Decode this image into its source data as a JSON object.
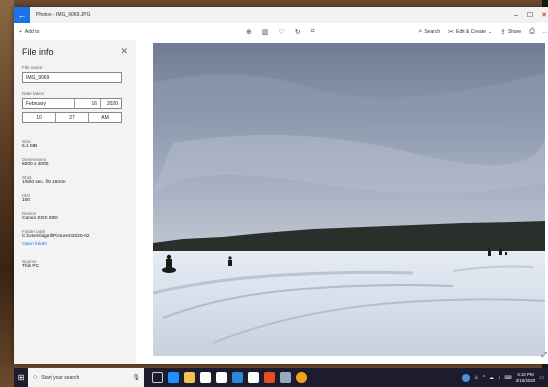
{
  "window": {
    "title": "Photos - IMG_9069.JPG",
    "back_icon": "back-arrow-icon",
    "controls": {
      "minimize": "–",
      "maximize": "☐",
      "close": "✕"
    }
  },
  "toolbar": {
    "add_to": "Add to",
    "search": "Search",
    "edit_create": "Edit & Create",
    "share": "Share",
    "more": "..."
  },
  "panel": {
    "title": "File info",
    "file_name_label": "File name",
    "file_name_value": "IMG_9069",
    "date_taken_label": "Date taken",
    "date_month": "February",
    "date_day": "16",
    "date_year": "2020",
    "time_hour": "10",
    "time_minute": "27",
    "time_ampm": "AM",
    "size_label": "Size",
    "size_value": "5.1 MB",
    "dimensions_label": "Dimensions",
    "dimensions_value": "6000 x 4000",
    "shot_label": "Shot",
    "shot_value": "1/500 sec. f/9 18mm",
    "iso_label": "ISO",
    "iso_value": "100",
    "device_label": "Device",
    "device_value": "Canon EOS 80D",
    "folder_label": "Folder path",
    "folder_value": "C:\\Users\\sjpril\\Pictures\\2020-02",
    "open_folder": "Open folder",
    "source_label": "Source",
    "source_value": "This PC"
  },
  "taskbar": {
    "search_placeholder": "Start your search",
    "clock_time": "6:10 PM",
    "clock_date": "2/16/2020"
  },
  "colors": {
    "accent": "#1a73e8",
    "panel_bg": "#f3f3f3",
    "taskbar_bg": "#1c1c2e"
  }
}
